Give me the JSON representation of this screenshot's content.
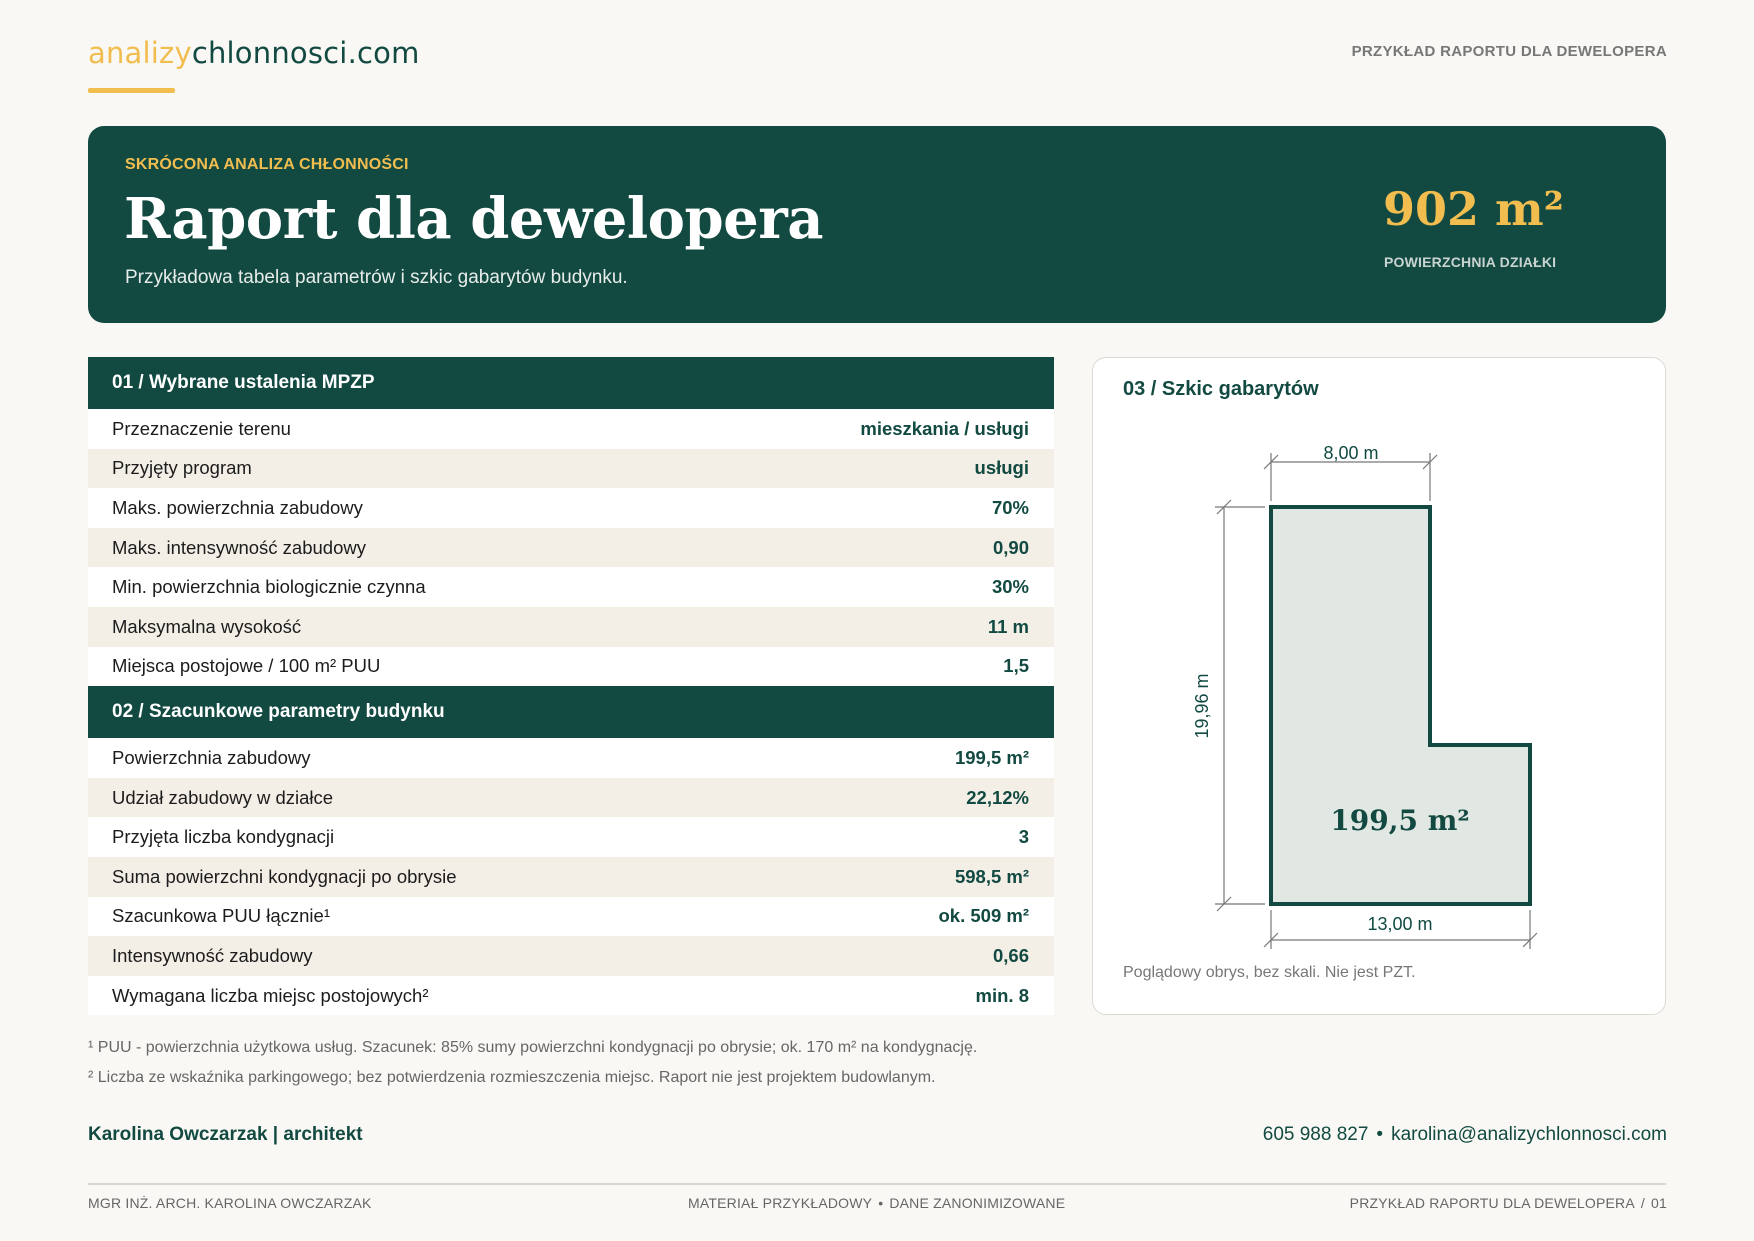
{
  "header": {
    "logo_part1": "analizy",
    "logo_part2": "chlonnosci.com",
    "top_right": "PRZYKŁAD RAPORTU DLA DEWELOPERA"
  },
  "hero": {
    "eyebrow": "SKRÓCONA ANALIZA CHŁONNOŚCI",
    "title": "Raport dla dewelopera",
    "subtitle": "Przykładowa tabela parametrów i szkic gabarytów budynku.",
    "area_value": "902 m²",
    "area_label": "POWIERZCHNIA DZIAŁKI"
  },
  "section1": {
    "title": "01 / Wybrane ustalenia MPZP",
    "rows": [
      {
        "label": "Przeznaczenie terenu",
        "value": "mieszkania / usługi"
      },
      {
        "label": "Przyjęty program",
        "value": "usługi"
      },
      {
        "label": "Maks. powierzchnia zabudowy",
        "value": "70%"
      },
      {
        "label": "Maks. intensywność zabudowy",
        "value": "0,90"
      },
      {
        "label": "Min. powierzchnia biologicznie czynna",
        "value": "30%"
      },
      {
        "label": "Maksymalna wysokość",
        "value": "11 m"
      },
      {
        "label": "Miejsca postojowe / 100 m² PUU",
        "value": "1,5"
      }
    ]
  },
  "section2": {
    "title": "02 / Szacunkowe parametry budynku",
    "rows": [
      {
        "label": "Powierzchnia zabudowy",
        "value": "199,5 m²"
      },
      {
        "label": "Udział zabudowy w działce",
        "value": "22,12%"
      },
      {
        "label": "Przyjęta liczba kondygnacji",
        "value": "3"
      },
      {
        "label": "Suma powierzchni kondygnacji po obrysie",
        "value": "598,5 m²"
      },
      {
        "label": "Szacunkowa PUU łącznie¹",
        "value": "ok. 509 m²"
      },
      {
        "label": "Intensywność zabudowy",
        "value": "0,66"
      },
      {
        "label": "Wymagana liczba miejsc postojowych²",
        "value": "min. 8"
      }
    ]
  },
  "sketch": {
    "title": "03 / Szkic gabarytów",
    "dim_top": "8,00 m",
    "dim_left": "19,96 m",
    "dim_bottom": "13,00 m",
    "area": "199,5 m²",
    "caption": "Poglądowy obrys, bez skali. Nie jest PZT.",
    "colors": {
      "outline": "#124a42",
      "fill": "#e1e7e3",
      "dim": "#777777"
    }
  },
  "footnotes": {
    "note1": "¹ PUU - powierzchnia użytkowa usług. Szacunek: 85% sumy powierzchni kondygnacji po obrysie; ok. 170 m² na kondygnację.",
    "note2": "² Liczba ze wskaźnika parkingowego; bez potwierdzenia rozmieszczenia miejsc. Raport nie jest projektem budowlanym."
  },
  "contact": {
    "author": "Karolina Owczarzak | architekt",
    "phone": "605 988 827",
    "separator": "•",
    "email": "karolina@analizychlonnosci.com"
  },
  "footer": {
    "left": "MGR INŻ. ARCH. KAROLINA OWCZARZAK",
    "center_a": "MATERIAŁ PRZYKŁADOWY",
    "center_sep": "•",
    "center_b": "DANE ZANONIMIZOWANE",
    "right_a": "PRZYKŁAD RAPORTU DLA DEWELOPERA",
    "right_sep": "/",
    "right_b": "01"
  },
  "colors": {
    "brand_green": "#124a42",
    "accent_yellow": "#f2bd4f",
    "page_bg": "#f9f8f4"
  }
}
